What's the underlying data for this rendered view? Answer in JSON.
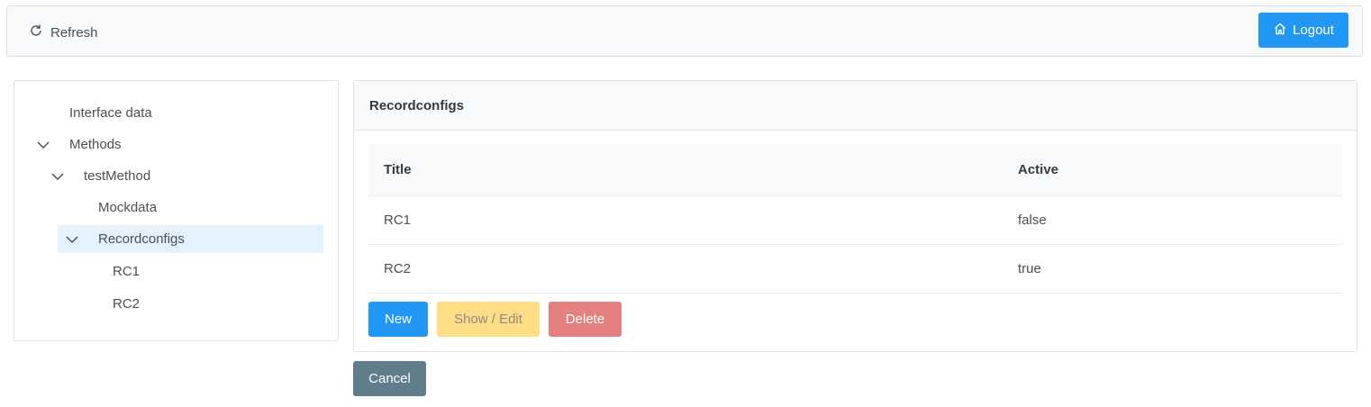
{
  "toolbar": {
    "refresh_label": "Refresh",
    "refresh_icon": "refresh-icon",
    "logout_label": "Logout",
    "logout_icon": "home-icon"
  },
  "tree": {
    "nodes": [
      {
        "label": "Interface data",
        "expanded": null,
        "selected": false
      },
      {
        "label": "Methods",
        "expanded": true,
        "selected": false
      },
      {
        "label": "testMethod",
        "expanded": true,
        "selected": false
      },
      {
        "label": "Mockdata",
        "expanded": null,
        "selected": false
      },
      {
        "label": "Recordconfigs",
        "expanded": true,
        "selected": true
      },
      {
        "label": "RC1",
        "expanded": null,
        "selected": false
      },
      {
        "label": "RC2",
        "expanded": null,
        "selected": false
      }
    ]
  },
  "panel": {
    "title": "Recordconfigs",
    "columns": [
      "Title",
      "Active"
    ],
    "rows": [
      [
        "RC1",
        "false"
      ],
      [
        "RC2",
        "true"
      ]
    ],
    "buttons": {
      "new": "New",
      "show_edit": "Show / Edit",
      "delete": "Delete"
    }
  },
  "footer": {
    "cancel_label": "Cancel"
  },
  "colors": {
    "primary": "#2196f3",
    "warning": "#ffdd84",
    "danger": "#e58080",
    "secondary": "#607d8b",
    "selected_node": "#e3f2fd"
  }
}
